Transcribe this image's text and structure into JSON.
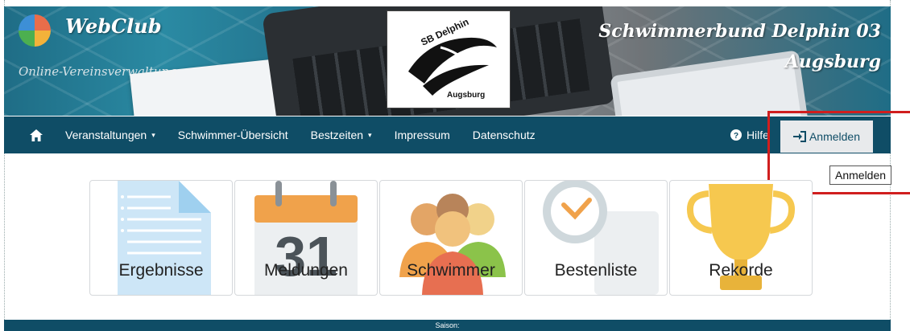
{
  "header": {
    "app_name": "WebClub",
    "app_subtitle": "Online-Vereinsverwaltung",
    "club_line1": "Schwimmerbund Delphin 03",
    "club_line2": "Augsburg",
    "emblem_top": "SB Delphin",
    "emblem_bottom": "Augsburg"
  },
  "nav": {
    "home_icon": "home-icon",
    "items": [
      {
        "label": "Veranstaltungen",
        "has_caret": true
      },
      {
        "label": "Schwimmer-Übersicht",
        "has_caret": false
      },
      {
        "label": "Bestzeiten",
        "has_caret": true
      },
      {
        "label": "Impressum",
        "has_caret": false
      },
      {
        "label": "Datenschutz",
        "has_caret": false
      }
    ],
    "help_label": "Hilfe",
    "login_label": "Anmelden"
  },
  "tooltip": "Anmelden",
  "tiles": [
    {
      "label": "Ergebnisse",
      "icon": "document-icon"
    },
    {
      "label": "Meldungen",
      "icon": "calendar-icon",
      "calendar_day": "31"
    },
    {
      "label": "Schwimmer",
      "icon": "people-icon"
    },
    {
      "label": "Bestenliste",
      "icon": "clock-icon"
    },
    {
      "label": "Rekorde",
      "icon": "trophy-icon"
    }
  ],
  "footer": {
    "season_label": "Saison:"
  },
  "colors": {
    "nav_bg": "#0f4d66",
    "highlight": "#d01e1e"
  }
}
